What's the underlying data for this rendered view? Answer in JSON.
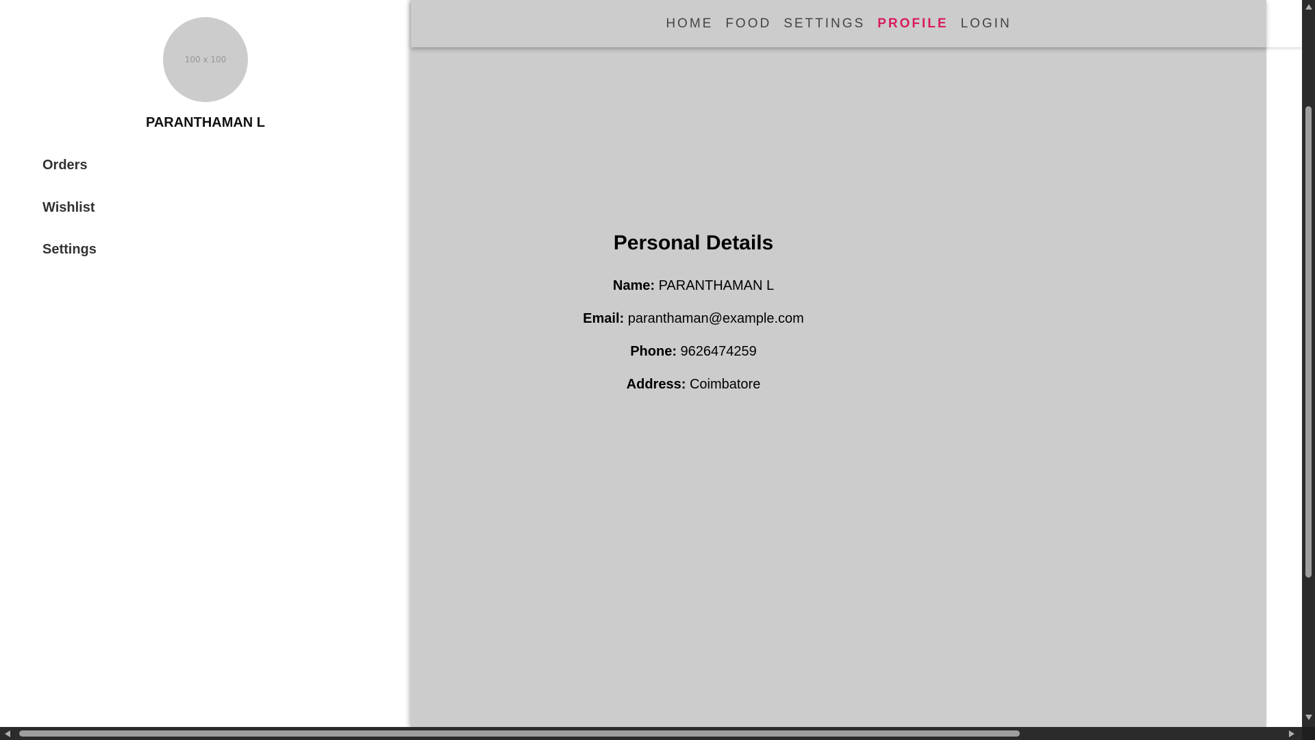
{
  "sidebar": {
    "avatar_text": "100 x 100",
    "user_name": "PARANTHAMAN L",
    "items": [
      {
        "label": "Orders"
      },
      {
        "label": "Wishlist"
      },
      {
        "label": "Settings"
      }
    ]
  },
  "nav": {
    "items": [
      {
        "label": "HOME",
        "active": false
      },
      {
        "label": "FOOD",
        "active": false
      },
      {
        "label": "SETTINGS",
        "active": false
      },
      {
        "label": "PROFILE",
        "active": true
      },
      {
        "label": "LOGIN",
        "active": false
      }
    ],
    "active_color": "#d81b60"
  },
  "details": {
    "title": "Personal Details",
    "rows": [
      {
        "label": "Name:",
        "value": "PARANTHAMAN L"
      },
      {
        "label": "Email:",
        "value": "paranthaman@example.com"
      },
      {
        "label": "Phone:",
        "value": "9626474259"
      },
      {
        "label": "Address:",
        "value": "Coimbatore"
      }
    ]
  },
  "colors": {
    "main_background": "#cccccc",
    "sidebar_background": "#ffffff",
    "scrollbar_background": "#2b2b2b"
  }
}
